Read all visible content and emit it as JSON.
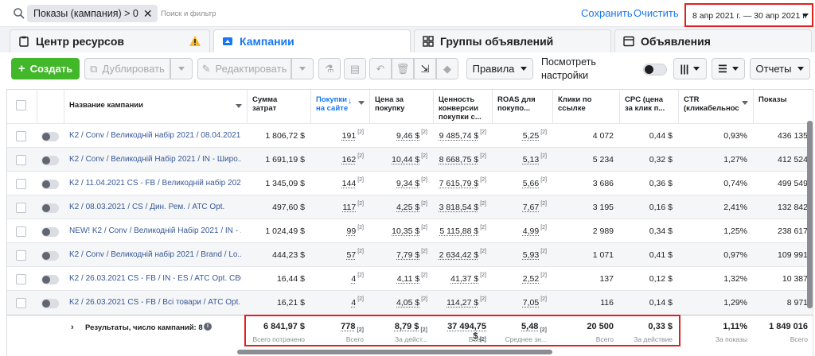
{
  "filter_bar": {
    "chip_label": "Показы (кампания) > 0",
    "placeholder": "Поиск и фильтр",
    "save": "Сохранить",
    "clear": "Очистить",
    "date_range": "8 апр 2021 г. — 30 апр 2021 г."
  },
  "tabs": [
    "Центр ресурсов",
    "Кампании",
    "Группы объявлений",
    "Объявления"
  ],
  "toolbar": {
    "create": "Создать",
    "duplicate": "Дублировать",
    "edit": "Редактировать",
    "rules": "Правила",
    "view_settings": "Посмотреть настройки",
    "reports": "Отчеты"
  },
  "columns": [
    "Название кампании",
    "Сумма затрат",
    "Покупки на сайте",
    "Цена за покупку",
    "Ценность конверсии покупки с...",
    "ROAS для покупо...",
    "Клики по ссылке",
    "CPC (цена за клик п...",
    "CTR (кликабельнос",
    "Показы"
  ],
  "rows": [
    {
      "name": "K2 / Conv / Великодній набір 2021 / 08.04.2021",
      "spend": "1 806,72 $",
      "purchases": "191",
      "cpp": "9,46 $",
      "value": "9 485,74 $",
      "roas": "5,25",
      "clicks": "4 072",
      "cpc": "0,44 $",
      "ctr": "0,93%",
      "impr": "436 135"
    },
    {
      "name": "K2 / Conv / Великодній Набір 2021 / IN - Широ...",
      "spend": "1 691,19 $",
      "purchases": "162",
      "cpp": "10,44 $",
      "value": "8 668,75 $",
      "roas": "5,13",
      "clicks": "5 234",
      "cpc": "0,32 $",
      "ctr": "1,27%",
      "impr": "412 524"
    },
    {
      "name": "K2 / 11.04.2021 CS - FB / Великодній набір 202...",
      "spend": "1 345,09 $",
      "purchases": "144",
      "cpp": "9,34 $",
      "value": "7 615,79 $",
      "roas": "5,66",
      "clicks": "3 686",
      "cpc": "0,36 $",
      "ctr": "0,74%",
      "impr": "499 549"
    },
    {
      "name": "K2 / 08.03.2021 / CS / Дин. Рем. / ATC Opt.",
      "spend": "497,60 $",
      "purchases": "117",
      "cpp": "4,25 $",
      "value": "3 818,54 $",
      "roas": "7,67",
      "clicks": "3 195",
      "cpc": "0,16 $",
      "ctr": "2,41%",
      "impr": "132 842"
    },
    {
      "name": "NEW! K2 / Conv / Великодній Набір 2021 / IN - ...",
      "spend": "1 024,49 $",
      "purchases": "99",
      "cpp": "10,35 $",
      "value": "5 115,88 $",
      "roas": "4,99",
      "clicks": "2 989",
      "cpc": "0,34 $",
      "ctr": "1,25%",
      "impr": "238 617"
    },
    {
      "name": "K2 / Conv / Великодній набір 2021 / Brand / Lo...",
      "spend": "444,23 $",
      "purchases": "57",
      "cpp": "7,79 $",
      "value": "2 634,42 $",
      "roas": "5,93",
      "clicks": "1 071",
      "cpc": "0,41 $",
      "ctr": "0,97%",
      "impr": "109 991"
    },
    {
      "name": "K2 / 26.03.2021 CS - FB / IN - ES / ATC Opt. CBO",
      "spend": "16,44 $",
      "purchases": "4",
      "cpp": "4,11 $",
      "value": "41,37 $",
      "roas": "2,52",
      "clicks": "137",
      "cpc": "0,12 $",
      "ctr": "1,32%",
      "impr": "10 387"
    },
    {
      "name": "K2 / 26.03.2021 CS - FB / Всі товари / ATC Opt.",
      "spend": "16,21 $",
      "purchases": "4",
      "cpp": "4,05 $",
      "value": "114,27 $",
      "roas": "7,05",
      "clicks": "116",
      "cpc": "0,14 $",
      "ctr": "1,29%",
      "impr": "8 971"
    }
  ],
  "footnote": "[2]",
  "summary": {
    "label": "Результаты, число кампаний: 8",
    "spend": "6 841,97 $",
    "spend_sub": "Всего потрачено",
    "purchases": "778",
    "purchases_sub": "Всего",
    "cpp": "8,79 $",
    "cpp_sub": "За дейст...",
    "value": "37 494,75 $",
    "value_sub": "Всего",
    "roas": "5,48",
    "roas_sub": "Среднее зн...",
    "clicks": "20 500",
    "clicks_sub": "Всего",
    "cpc": "0,33 $",
    "cpc_sub": "За действие",
    "ctr": "1,11%",
    "ctr_sub": "За показы",
    "impr": "1 849 016",
    "impr_sub": "Всего"
  },
  "colors": {
    "accent": "#1877f2",
    "create": "#42b72a",
    "highlight": "#e02020"
  }
}
